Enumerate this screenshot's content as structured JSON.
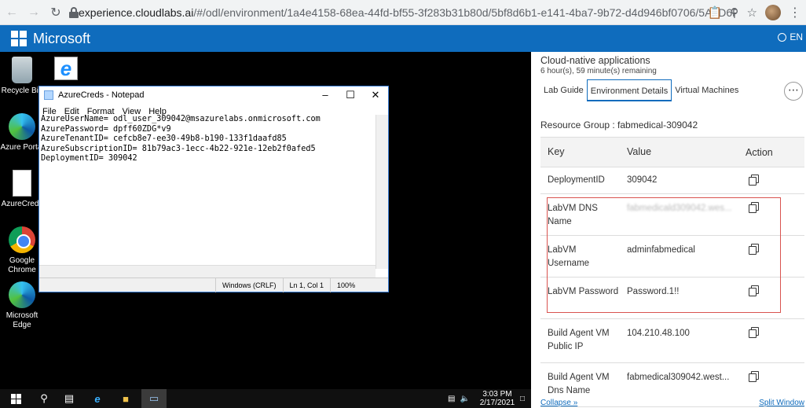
{
  "browser": {
    "url_host": "experience.cloudlabs.ai",
    "url_rest": "/#/odl/environment/1a4e4158-68ea-44fd-bf55-3f283b31b80d/5bf8d6b1-e141-4ba7-9b72-d4d946bf0706/5A6D6F6953664162327..."
  },
  "header": {
    "brand": "Microsoft",
    "lang": "EN"
  },
  "desktop": {
    "icons": [
      {
        "label": "Recycle Bin"
      },
      {
        "label": "Azure Portal"
      },
      {
        "label": "AzureCreds"
      },
      {
        "label": "Google Chrome"
      },
      {
        "label": "Microsoft Edge"
      }
    ]
  },
  "notepad": {
    "title": "AzureCreds - Notepad",
    "menu": [
      "File",
      "Edit",
      "Format",
      "View",
      "Help"
    ],
    "content": "AzureUserName= odl_user_309042@msazurelabs.onmicrosoft.com\nAzurePassword= dpff60ZDG*v9\nAzureTenantID= cefcb8e7-ee30-49b8-b190-133f1daafd85\nAzureSubscriptionID= 81b79ac3-1ecc-4b22-921e-12eb2f0afed5\nDeploymentID= 309042",
    "status": {
      "encoding": "Windows (CRLF)",
      "position": "Ln 1, Col 1",
      "zoom": "100%"
    }
  },
  "taskbar": {
    "time": "3:03 PM",
    "date": "2/17/2021"
  },
  "panel": {
    "title": "Cloud-native applications",
    "time_remaining": "6 hour(s), 59 minute(s) remaining",
    "tabs": [
      "Lab Guide",
      "Environment Details",
      "Virtual Machines"
    ],
    "active_tab": "Environment Details",
    "resource_group": "Resource Group : fabmedical-309042",
    "table": {
      "headers": [
        "Key",
        "Value",
        "Action"
      ],
      "rows": [
        {
          "key": "DeploymentID",
          "value": "309042"
        },
        {
          "key": "LabVM DNS Name",
          "value": "fabmedicald309042.wes..."
        },
        {
          "key": "LabVM Username",
          "value": "adminfabmedical"
        },
        {
          "key": "LabVM Password",
          "value": "Password.1!!"
        },
        {
          "key": "Build Agent VM Public IP",
          "value": "104.210.48.100"
        },
        {
          "key": "Build Agent VM Dns Name",
          "value": "fabmedical309042.west..."
        }
      ]
    },
    "footer": {
      "collapse": "Collapse »",
      "split": "Split Window"
    },
    "colors": {
      "brand": "#0f6cbd",
      "highlight": "#d9534f"
    }
  }
}
